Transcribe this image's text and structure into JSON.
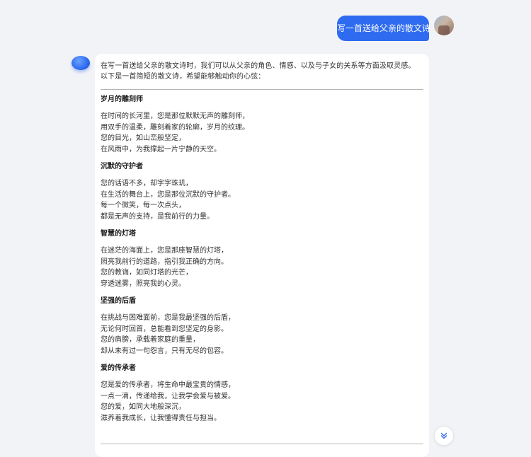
{
  "user_message": {
    "text": "写一首送给父亲的散文诗"
  },
  "assistant_message": {
    "intro_line1": "在写一首送给父亲的散文诗时，我们可以从父亲的角色、情感、以及与子女的关系等方面汲取灵感。",
    "intro_line2": "以下是一首简短的散文诗，希望能够触动你的心弦：",
    "sections": [
      {
        "title": "岁月的雕刻师",
        "lines": [
          "在时间的长河里，您是那位默默无声的雕刻师，",
          "用双手的温柔，雕刻着家的轮廓，岁月的纹理。",
          "您的目光，如山峦般坚定，",
          "在风雨中，为我撑起一片宁静的天空。"
        ]
      },
      {
        "title": "沉默的守护者",
        "lines": [
          "您的话语不多，却字字珠玑，",
          "在生活的舞台上，您是那位沉默的守护者。",
          "每一个微笑，每一次点头，",
          "都是无声的支持，是我前行的力量。"
        ]
      },
      {
        "title": "智慧的灯塔",
        "lines": [
          "在迷茫的海面上，您是那座智慧的灯塔，",
          "照亮我前行的道路，指引我正确的方向。",
          "您的教诲，如同灯塔的光芒，",
          "穿透迷雾，照亮我的心灵。"
        ]
      },
      {
        "title": "坚强的后盾",
        "lines": [
          "在挑战与困难面前，您是我最坚强的后盾，",
          "无论何时回首，总能看到您坚定的身影。",
          "您的肩膀，承载着家庭的重量，",
          "却从未有过一句怨言，只有无尽的包容。"
        ]
      },
      {
        "title": "爱的传承者",
        "lines": [
          "您是爱的传承者，将生命中最宝贵的情感，",
          "一点一滴，传递给我，让我学会爱与被爱。",
          "您的爱，如同大地般深沉，",
          "滋养着我成长，让我懂得责任与担当。"
        ]
      }
    ]
  },
  "icons": {
    "scroll_down": "chevron-double-down-icon",
    "bot_avatar": "assistant-avatar-icon",
    "user_avatar": "user-avatar"
  },
  "colors": {
    "accent": "#2e6bf0",
    "background": "#f2f3f6",
    "card": "#ffffff"
  }
}
